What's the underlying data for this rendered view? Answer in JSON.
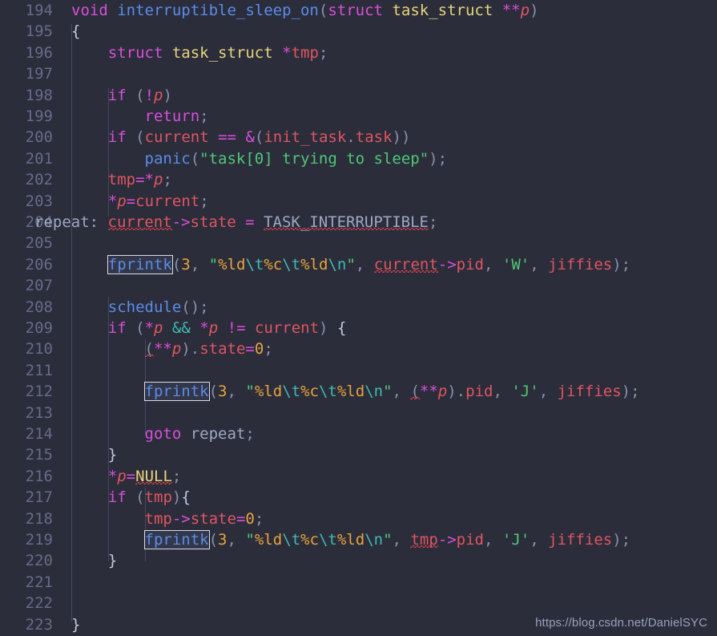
{
  "editor": {
    "theme_name": "dark-dracula",
    "background": "#2b2d3b",
    "gutter_background": "#2b2d3b",
    "line_number_color": "#666b8a",
    "first_line": 194,
    "last_line": 223,
    "line_height_px": 26.4,
    "font_size_px": 19
  },
  "watermark": {
    "text": "https://blog.csdn.net/DanielSYC"
  },
  "line_numbers": [
    "194",
    "195",
    "196",
    "197",
    "198",
    "199",
    "200",
    "201",
    "202",
    "203",
    "204",
    "205",
    "206",
    "207",
    "208",
    "209",
    "210",
    "211",
    "212",
    "213",
    "214",
    "215",
    "216",
    "217",
    "218",
    "219",
    "220",
    "221",
    "222",
    "223"
  ],
  "code_lines": [
    {
      "n": 194,
      "text": "void interruptible_sleep_on(struct task_struct **p)"
    },
    {
      "n": 195,
      "text": "{"
    },
    {
      "n": 196,
      "text": "    struct task_struct *tmp;"
    },
    {
      "n": 197,
      "text": ""
    },
    {
      "n": 198,
      "text": "    if (!p)"
    },
    {
      "n": 199,
      "text": "        return;"
    },
    {
      "n": 200,
      "text": "    if (current == &(init_task.task))"
    },
    {
      "n": 201,
      "text": "        panic(\"task[0] trying to sleep\");"
    },
    {
      "n": 202,
      "text": "    tmp=*p;"
    },
    {
      "n": 203,
      "text": "    *p=current;"
    },
    {
      "n": 204,
      "text": "repeat: current->state = TASK_INTERRUPTIBLE;"
    },
    {
      "n": 205,
      "text": ""
    },
    {
      "n": 206,
      "text": "    fprintk(3, \"%ld\\t%c\\t%ld\\n\", current->pid, 'W', jiffies);"
    },
    {
      "n": 207,
      "text": ""
    },
    {
      "n": 208,
      "text": "    schedule();"
    },
    {
      "n": 209,
      "text": "    if (*p && *p != current) {"
    },
    {
      "n": 210,
      "text": "        (**p).state=0;"
    },
    {
      "n": 211,
      "text": ""
    },
    {
      "n": 212,
      "text": "        fprintk(3, \"%ld\\t%c\\t%ld\\n\", (**p).pid, 'J', jiffies);"
    },
    {
      "n": 213,
      "text": ""
    },
    {
      "n": 214,
      "text": "        goto repeat;"
    },
    {
      "n": 215,
      "text": "    }"
    },
    {
      "n": 216,
      "text": "    *p=NULL;"
    },
    {
      "n": 217,
      "text": "    if (tmp){"
    },
    {
      "n": 218,
      "text": "        tmp->state=0;"
    },
    {
      "n": 219,
      "text": "        fprintk(3, \"%ld\\t%c\\t%ld\\n\", tmp->pid, 'J', jiffies);"
    },
    {
      "n": 220,
      "text": "    }"
    },
    {
      "n": 221,
      "text": ""
    },
    {
      "n": 222,
      "text": ""
    },
    {
      "n": 223,
      "text": "}"
    }
  ],
  "highlights": {
    "occurrence_token": "fprintk",
    "occurrence_lines": [
      206,
      212,
      219
    ],
    "occurrence_border_color": "#d8dbe8",
    "error_squiggle_color": "#e0434f",
    "squiggled_tokens": [
      "current",
      "TASK_INTERRUPTIBLE",
      "current",
      "(",
      "(",
      "NULL",
      "fprintk",
      "tmp"
    ]
  },
  "token_colors": {
    "keyword": "#d94fd8",
    "function": "#5b8ce8",
    "type": "#e8d57a",
    "variable": "#e05561",
    "operator": "#d94fd8",
    "logical_and": "#3fb8b0",
    "punctuation": "#8a90ad",
    "string": "#50c878",
    "escape": "#3fb8b0",
    "format_spec": "#e8a33d",
    "number": "#e8a33d",
    "plain": "#a0a6c4",
    "macro": "#e8d57a"
  }
}
